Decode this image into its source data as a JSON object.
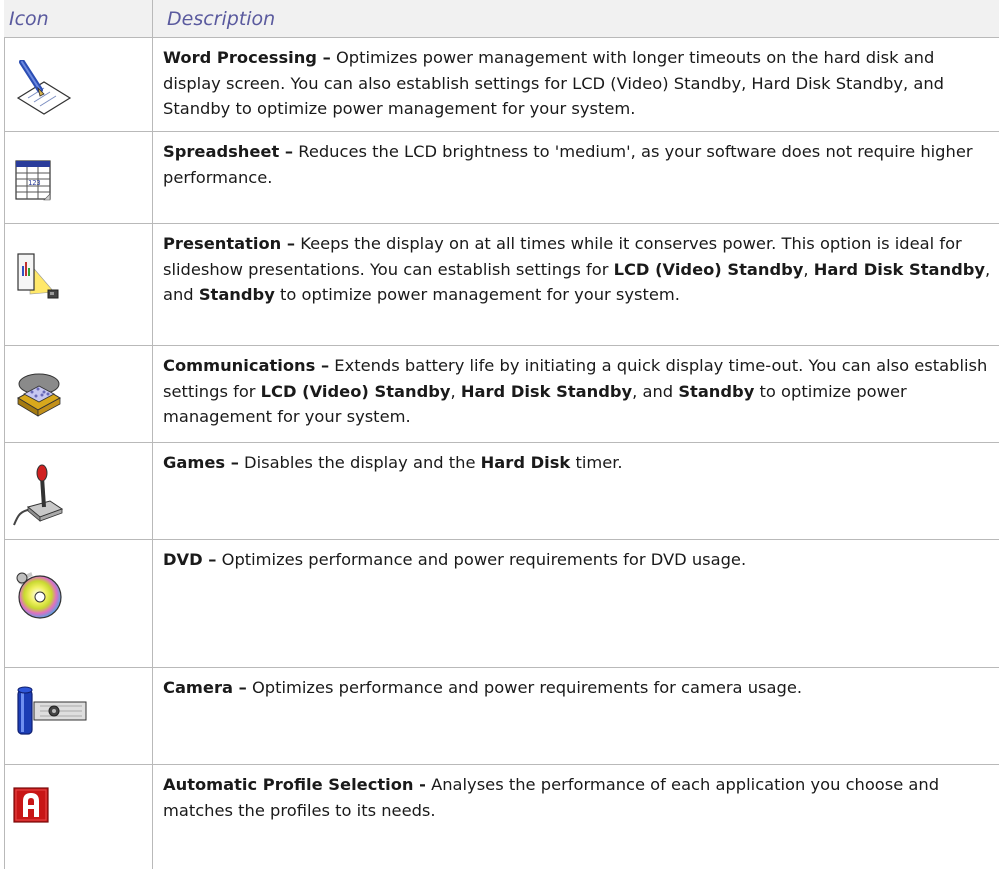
{
  "header": {
    "icon": "Icon",
    "description": "Description"
  },
  "rows": [
    {
      "icon": "word-processing-icon",
      "parts": [
        {
          "b": "Word Processing –"
        },
        {
          "t": " Optimizes power management with longer timeouts on the hard disk and display screen. You can also establish settings for LCD (Video) Standby, Hard Disk Standby, and Standby to optimize power management for your system."
        }
      ]
    },
    {
      "icon": "spreadsheet-icon",
      "parts": [
        {
          "b": "Spreadsheet –"
        },
        {
          "t": " Reduces the LCD brightness to 'medium', as your software does not require higher performance."
        }
      ]
    },
    {
      "icon": "presentation-icon",
      "parts": [
        {
          "b": "Presentation –"
        },
        {
          "t": " Keeps the display on at all times while it conserves power. This option is ideal for slideshow presentations. You can establish settings for "
        },
        {
          "b": "LCD (Video) Standby"
        },
        {
          "t": ", "
        },
        {
          "b": "Hard Disk Standby"
        },
        {
          "t": ", and "
        },
        {
          "b": "Standby"
        },
        {
          "t": " to optimize power management for your system."
        }
      ]
    },
    {
      "icon": "communications-icon",
      "parts": [
        {
          "b": "Communications –"
        },
        {
          "t": " Extends battery life by initiating a quick display time-out. You can also establish settings for "
        },
        {
          "b": "LCD (Video) Standby"
        },
        {
          "t": ", "
        },
        {
          "b": "Hard Disk Standby"
        },
        {
          "t": ", and "
        },
        {
          "b": "Standby"
        },
        {
          "t": " to optimize power management for your system."
        }
      ]
    },
    {
      "icon": "games-joystick-icon",
      "parts": [
        {
          "b": "Games –"
        },
        {
          "t": " Disables the display and the "
        },
        {
          "b": "Hard Disk"
        },
        {
          "t": " timer."
        }
      ]
    },
    {
      "icon": "dvd-disc-icon",
      "parts": [
        {
          "b": "DVD –"
        },
        {
          "t": " Optimizes performance and power requirements for DVD usage."
        }
      ]
    },
    {
      "icon": "camera-icon",
      "parts": [
        {
          "b": "Camera –"
        },
        {
          "t": " Optimizes performance and power requirements for camera usage."
        }
      ]
    },
    {
      "icon": "automatic-profile-icon",
      "parts": [
        {
          "b": "Automatic Profile Selection -"
        },
        {
          "t": " Analyses the performance of each application you choose and matches the profiles to its needs."
        }
      ]
    }
  ]
}
